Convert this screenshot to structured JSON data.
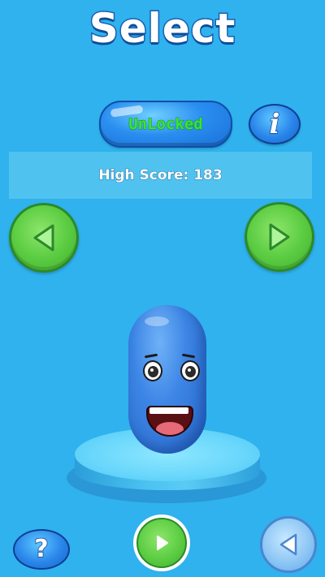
{
  "screen": {
    "title": "Select"
  },
  "unlock_button": {
    "label": "UnLocked"
  },
  "info_button": {
    "label": "i"
  },
  "high_score": {
    "label": "High Score: 183"
  },
  "nav": {
    "left_icon": "triangle-left-icon",
    "right_icon": "triangle-right-icon"
  },
  "character": {
    "color": "#3d86e6"
  },
  "footer": {
    "help_label": "?",
    "play_icon": "play-icon",
    "back_icon": "back-icon"
  },
  "colors": {
    "background": "#2fb2ee",
    "unlock_text": "#37e53a",
    "green_button": "#5ccd43"
  }
}
